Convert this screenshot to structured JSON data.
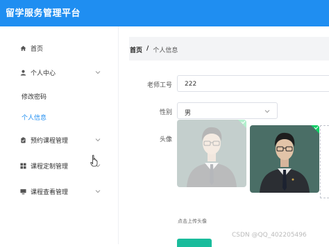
{
  "app": {
    "title": "留学服务管理平台"
  },
  "sidebar": {
    "items": [
      {
        "label": "首页",
        "icon": "home-icon"
      },
      {
        "label": "个人中心",
        "icon": "user-icon",
        "expanded": true,
        "children": [
          {
            "label": "修改密码"
          },
          {
            "label": "个人信息",
            "active": true
          }
        ]
      },
      {
        "label": "预约课程管理",
        "icon": "clipboard-icon"
      },
      {
        "label": "课程定制管理",
        "icon": "grid-icon"
      },
      {
        "label": "课程查看管理",
        "icon": "monitor-icon"
      }
    ]
  },
  "breadcrumb": {
    "home": "首页",
    "separator": "/",
    "current": "个人信息"
  },
  "form": {
    "teacher_no_label": "老师工号",
    "teacher_no_value": "222",
    "gender_label": "性别",
    "gender_value": "男",
    "avatar_label": "头像",
    "upload_hint": "点击上传头像"
  },
  "watermark": "CSDN @QQ_402205496",
  "colors": {
    "accent": "#1f8ef1",
    "submit": "#1abc9c"
  }
}
